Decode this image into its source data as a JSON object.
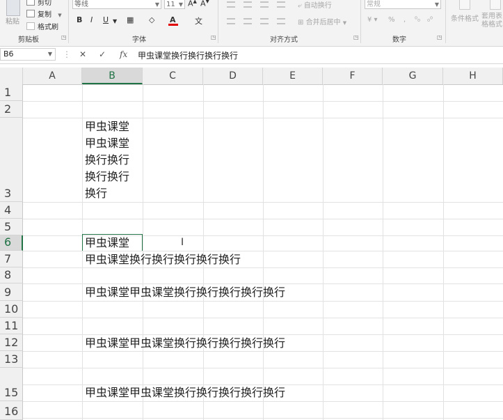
{
  "ribbon": {
    "clipboard": {
      "paste": "粘贴",
      "cut": "剪切",
      "copy": "复制",
      "format_painter": "格式刷",
      "label": "剪贴板"
    },
    "font": {
      "font_name": "等线",
      "font_size": "11",
      "label": "字体",
      "bold": "B",
      "italic": "I",
      "underline": "U",
      "font_color": "A"
    },
    "alignment": {
      "wrap_text": "自动换行",
      "merge_center": "合并后居中",
      "label": "对齐方式"
    },
    "number": {
      "format": "常规",
      "percent": "%",
      "comma": ",",
      "label": "数字"
    },
    "styles": {
      "conditional": "条件格式",
      "table": "套用表格格式"
    }
  },
  "formula_bar": {
    "name_box": "B6",
    "cancel": "✕",
    "enter": "✓",
    "fx": "fx",
    "content": "甲虫课堂换行换行换行换行"
  },
  "columns": [
    "A",
    "B",
    "C",
    "D",
    "E",
    "F",
    "G",
    "H"
  ],
  "active_column": "B",
  "rows": [
    "1",
    "2",
    "3",
    "4",
    "5",
    "6",
    "7",
    "8",
    "9",
    "10",
    "11",
    "12",
    "13",
    "15",
    "16"
  ],
  "active_row": "6",
  "cells": {
    "b3_lines": [
      "甲虫课堂",
      "甲虫课堂",
      "换行换行",
      "换行换行",
      "换行"
    ],
    "b6": "甲虫课堂",
    "b7": "甲虫课堂换行换行换行换行换行",
    "b9": "甲虫课堂甲虫课堂换行换行换行换行换行",
    "b12": "甲虫课堂甲虫课堂换行换行换行换行换行",
    "b15": "甲虫课堂甲虫课堂换行换行换行换行换行"
  },
  "colors": {
    "accent": "#217346",
    "font_color": "#e00000"
  }
}
